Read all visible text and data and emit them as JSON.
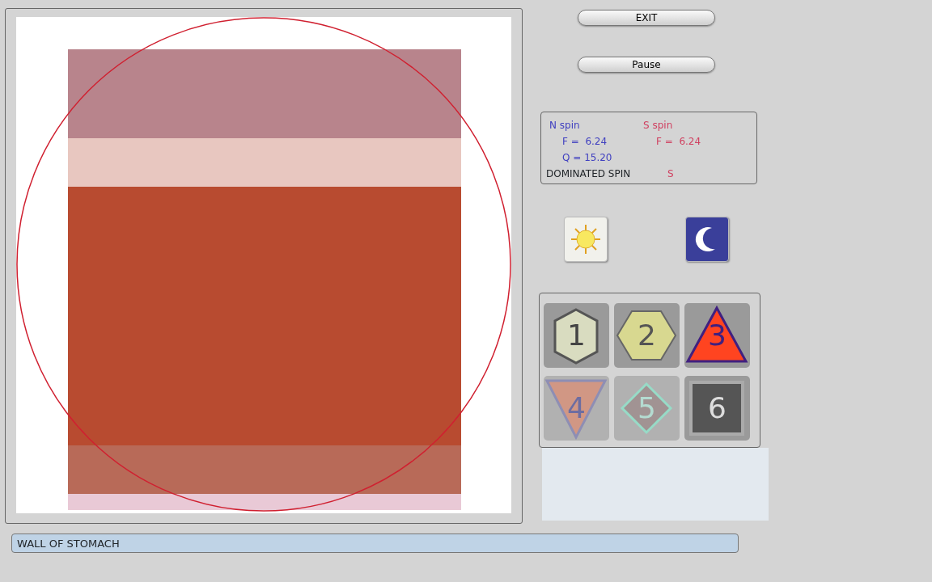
{
  "buttons": [
    {
      "label": "EXIT"
    },
    {
      "label": "Pause"
    }
  ],
  "spin_panel": {
    "n_title": "N spin",
    "n_f": "F =  6.24",
    "n_q": "Q = 15.20",
    "s_title": "S spin",
    "s_f": "F =  6.24",
    "dominated_label": "DOMINATED SPIN",
    "dominated_value": "S"
  },
  "tiles": [
    {
      "label": "1",
      "kind": "hexagon",
      "disabled": false
    },
    {
      "label": "2",
      "kind": "hexflat",
      "disabled": false
    },
    {
      "label": "3",
      "kind": "triangle",
      "disabled": false
    },
    {
      "label": "4",
      "kind": "triangle-down",
      "disabled": true
    },
    {
      "label": "5",
      "kind": "diamond",
      "disabled": true
    },
    {
      "label": "6",
      "kind": "square",
      "disabled": false
    }
  ],
  "status_bar": {
    "text": "WALL OF STOMACH"
  }
}
